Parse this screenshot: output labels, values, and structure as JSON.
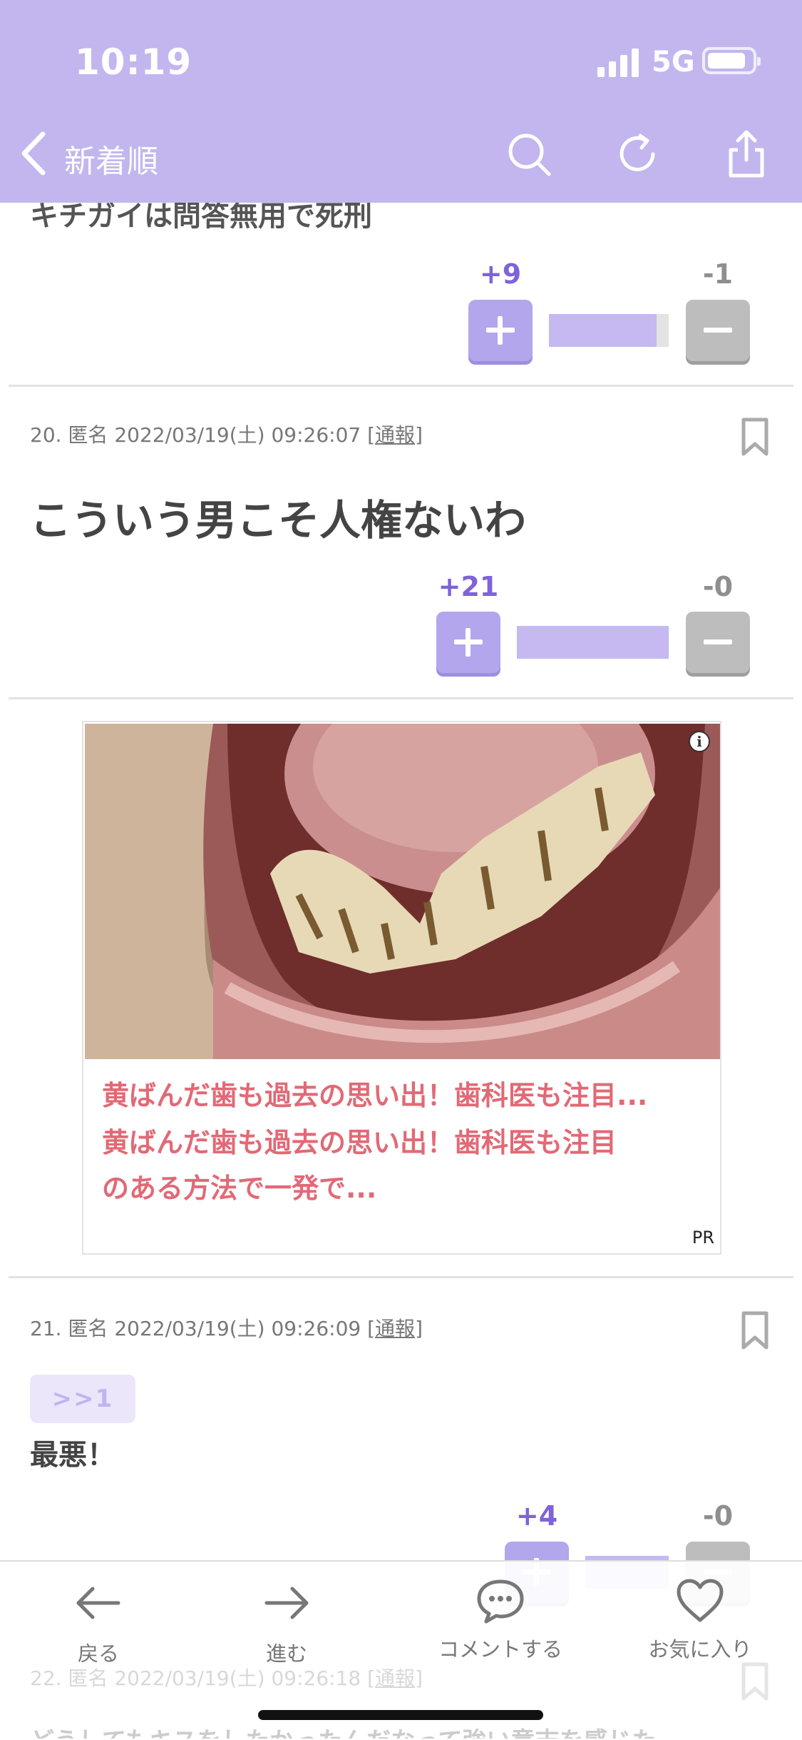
{
  "status_bar": {
    "time": "10:19",
    "network": "5G"
  },
  "nav": {
    "back_label": "新着順"
  },
  "posts": [
    {
      "partial_text": "キチガイは問答無用で死刑",
      "plus": "+9",
      "minus": "-1",
      "ratio": 0.9
    },
    {
      "meta_prefix": "20. 匿名 2022/03/19(土) 09:26:07 [",
      "report": "通報",
      "meta_suffix": "]",
      "body": "こういう男こそ人権ないわ",
      "plus": "+21",
      "minus": "-0",
      "ratio": 1.0
    },
    {
      "meta_prefix": "21. 匿名 2022/03/19(土) 09:26:09 [",
      "report": "通報",
      "meta_suffix": "]",
      "anchor": ">>1",
      "body": "最悪！",
      "plus": "+4",
      "minus": "-0",
      "ratio": 1.0
    },
    {
      "meta_prefix": "22. 匿名 2022/03/19(土) 09:26:18 [",
      "report": "通報",
      "meta_suffix": "]",
      "partial_text": "どうしてもキスをしたかったんだなって強い意志を感じた"
    }
  ],
  "ad": {
    "headline": "黄ばんだ歯も過去の思い出！歯科医も注目...",
    "line1": "黄ばんだ歯も過去の思い出！歯科医も注目",
    "line2": "のある方法で一発で...",
    "pr": "PR",
    "info": "i"
  },
  "bottom_nav": [
    {
      "label": "戻る",
      "icon": "arrow-left-icon"
    },
    {
      "label": "進む",
      "icon": "arrow-right-icon"
    },
    {
      "label": "コメントする",
      "icon": "comment-icon"
    },
    {
      "label": "お気に入り",
      "icon": "heart-icon"
    }
  ],
  "colors": {
    "header": "#c3b6ee",
    "accent": "#7e63da",
    "ad_text": "#e26976"
  }
}
